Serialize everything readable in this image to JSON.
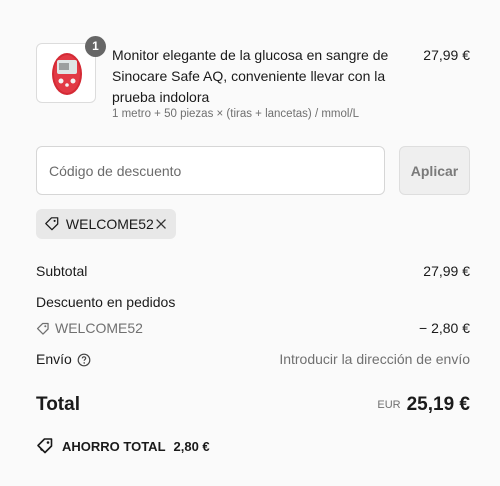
{
  "product": {
    "quantity": "1",
    "title": "Monitor elegante de la glucosa en sangre de Sinocare Safe AQ, conveniente llevar con la prueba indolora",
    "variant": "1 metro + 50 piezas × (tiras + lancetas) / mmol/L",
    "price": "27,99 €",
    "image_icon": "glucose-meter-image"
  },
  "discount": {
    "placeholder": "Código de descuento",
    "apply_label": "Aplicar",
    "applied_code": "WELCOME52"
  },
  "summary": {
    "subtotal_label": "Subtotal",
    "subtotal_value": "27,99 €",
    "order_discount_label": "Descuento en pedidos",
    "order_discount_code": "WELCOME52",
    "order_discount_value": "− 2,80 €",
    "shipping_label": "Envío",
    "shipping_value": "Introducir la dirección de envío",
    "total_label": "Total",
    "total_currency": "EUR",
    "total_value": "25,19 €",
    "savings_label": "AHORRO TOTAL",
    "savings_value": "2,80 €"
  },
  "colors": {
    "background": "#fafafa",
    "badge": "#666666",
    "meter_red": "#d42a35"
  }
}
